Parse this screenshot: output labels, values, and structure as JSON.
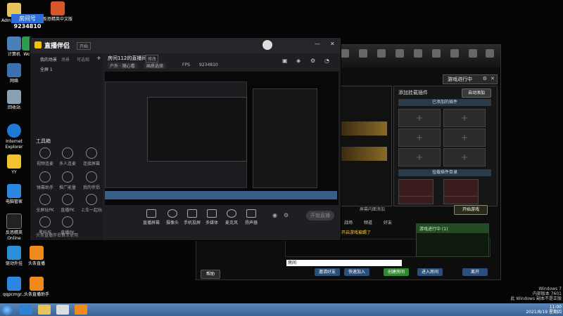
{
  "overlay": {
    "badge": "房间号",
    "number": "9234810"
  },
  "desktop": {
    "icons": [
      {
        "label": "Administrator"
      },
      {
        "label": "反恐精英中文版"
      },
      {
        "label": "计算机"
      },
      {
        "label": "Wo"
      },
      {
        "label": "网络"
      },
      {
        "label": "回收站"
      },
      {
        "label": "Internet Explorer"
      },
      {
        "label": "YY"
      },
      {
        "label": "电脑管家"
      },
      {
        "label": "反恐精英 Online"
      },
      {
        "label": "驱动外挂"
      },
      {
        "label": "头条直播"
      },
      {
        "label": "qqpcmgr..."
      },
      {
        "label": "头条直播助手"
      }
    ]
  },
  "stream": {
    "app_title": "直播伴侣",
    "sign_in": "开始",
    "tabs": [
      "我的场景",
      "场景",
      "可选观"
    ],
    "scene_item": "全屏 1",
    "room_title": "房间112的直播间",
    "room_tag": "修改",
    "toolbar_items": [
      "户外 · 随心看",
      "画质选择",
      "FPS",
      "9234810"
    ],
    "sidebar_title": "工具箱",
    "sidebar_tools": [
      "视频连麦",
      "多人连麦",
      "连接屏幕",
      "弹幕助手",
      "推广能量",
      "我的伴侣",
      "全屏玩PK",
      "直播PK",
      "上车一起玩",
      "黑科技",
      "直播PK"
    ],
    "notice": "头条直播伴侣首次使用",
    "bottom_tools": [
      "直播屏幕",
      "摄像头",
      "手机投屏",
      "多媒体",
      "麦克风",
      "扬声器"
    ],
    "start_button": "开始直播"
  },
  "game": {
    "title": "游戏进行中",
    "add_plugin": "添加挂载插件",
    "auto_add": "自动添加",
    "added_plugins": "已添加的插件",
    "plugin_list": "挂载插件目录",
    "start_game": "开始游戏",
    "room_prompt": "屏幕内面添加",
    "msg": "开启游戏被踢了",
    "tabs": [
      "战场",
      "频道",
      "好友"
    ],
    "chat_input": "房间",
    "buttons": [
      "邀请好友",
      "快速加入",
      "创建房间",
      "进入房间",
      "离开"
    ],
    "footer": "游戏进行中 (1)",
    "left_btn": "帮助"
  },
  "os": {
    "line1": "Windows 7",
    "line2": "内部版本 7601",
    "line3": "此 Windows 副本不是正版",
    "time": "11:00",
    "date": "2021/8/19 星期四"
  }
}
